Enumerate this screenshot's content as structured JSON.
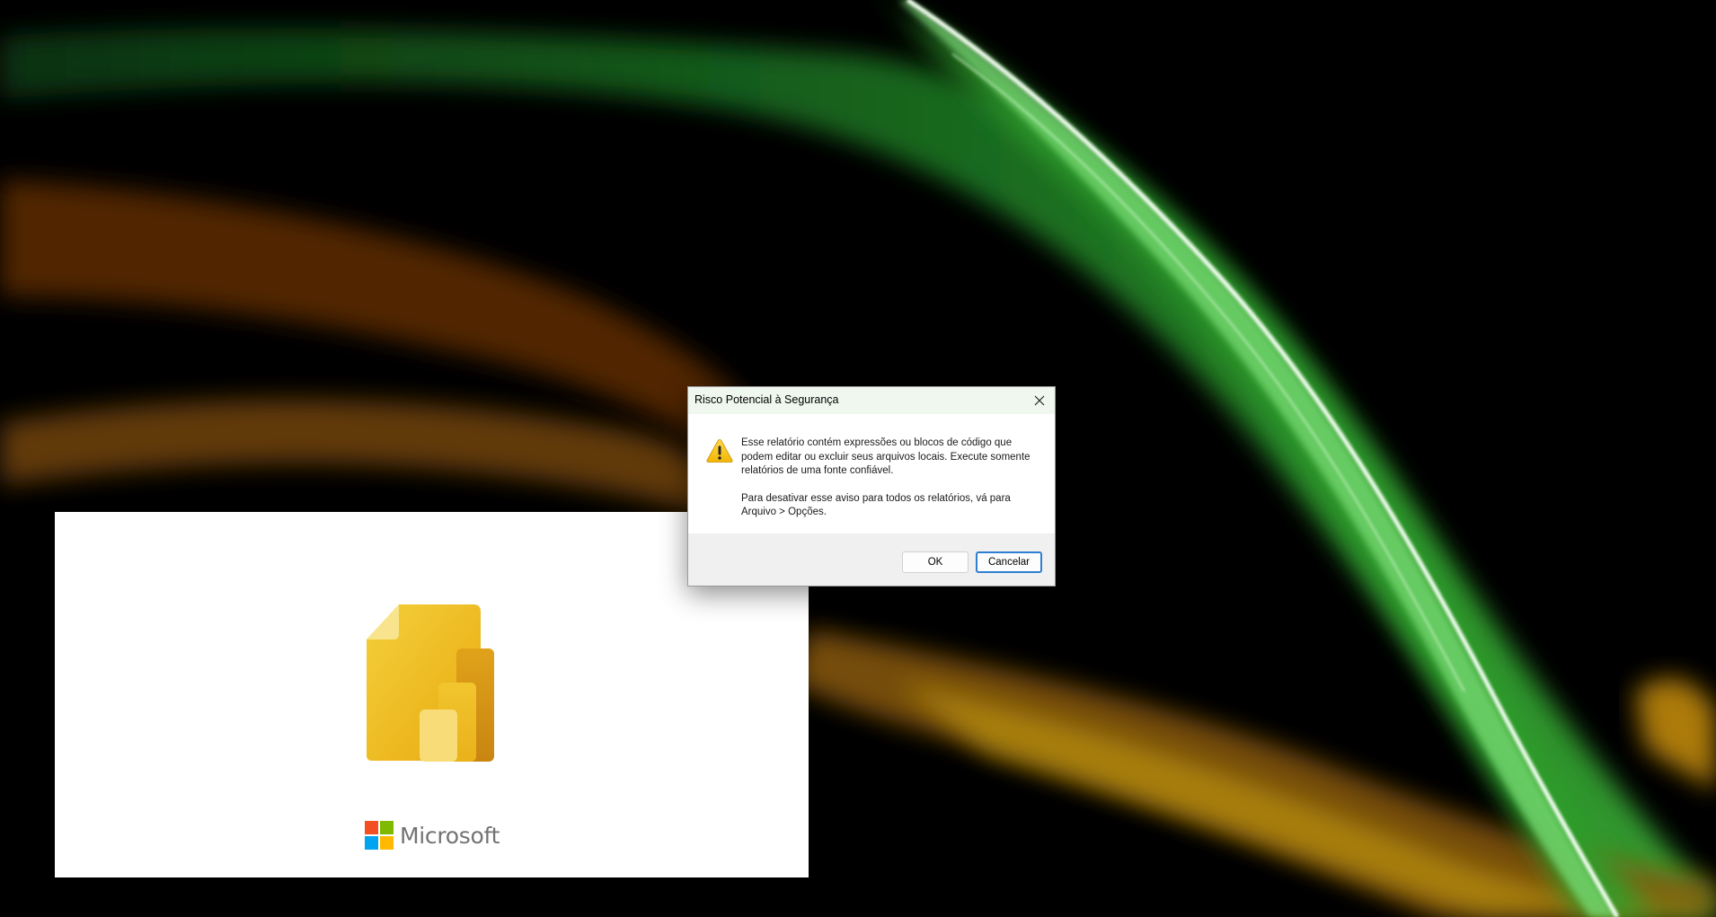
{
  "splash": {
    "brand_name": "Microsoft",
    "ms_logo_colors": [
      "#F25022",
      "#7FBA00",
      "#00A4EF",
      "#FFB900"
    ]
  },
  "dialog": {
    "title": "Risco Potencial à Segurança",
    "icon": "warning-icon",
    "message_1": "Esse relatório contém expressões ou blocos de código que podem editar ou excluir seus arquivos locais. Execute somente relatórios de uma fonte confiável.",
    "message_2": "Para desativar esse aviso para todos os relatórios, vá para Arquivo > Opções.",
    "ok_label": "OK",
    "cancel_label": "Cancelar",
    "default_button": "Cancelar",
    "accent_color": "#2F7FD1"
  }
}
